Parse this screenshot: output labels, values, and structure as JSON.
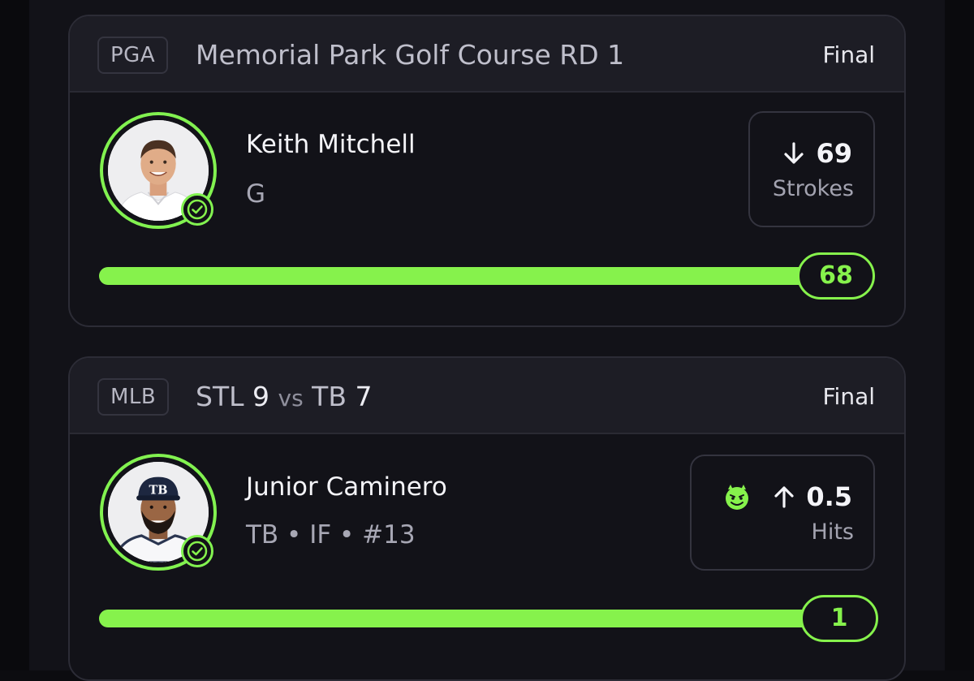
{
  "colors": {
    "accent": "#86f24c",
    "card_border": "#2c2c36",
    "header_bg": "#1d1d25",
    "background": "#121218"
  },
  "cards": [
    {
      "league": "PGA",
      "game": {
        "title": "Memorial Park Golf Course RD 1"
      },
      "status": "Final",
      "player": {
        "name": "Keith Mitchell",
        "meta": "G",
        "avatar_icon": "player-photo-golfer"
      },
      "stat": {
        "direction_icon": "arrow-down-icon",
        "line": "69",
        "label": "Strokes"
      },
      "result": "68",
      "progress_fraction": 1.0
    },
    {
      "league": "MLB",
      "game": {
        "away_team": "STL",
        "away_score": "9",
        "vs": "vs",
        "home_team": "TB",
        "home_score": "7"
      },
      "status": "Final",
      "player": {
        "name": "Junior Caminero",
        "meta": "TB • IF • #13",
        "avatar_icon": "player-photo-baseball"
      },
      "stat": {
        "modifier_icon": "demon-icon",
        "direction_icon": "arrow-up-icon",
        "line": "0.5",
        "label": "Hits"
      },
      "result": "1",
      "progress_fraction": 1.0
    }
  ]
}
